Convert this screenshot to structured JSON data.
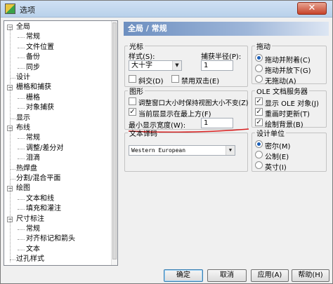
{
  "window": {
    "title": "选项",
    "close_glyph": "✕"
  },
  "tree": {
    "items": [
      {
        "label": "全局",
        "level": 0,
        "expander": "−"
      },
      {
        "label": "常规",
        "level": 1
      },
      {
        "label": "文件位置",
        "level": 1
      },
      {
        "label": "备份",
        "level": 1
      },
      {
        "label": "同步",
        "level": 1
      },
      {
        "label": "设计",
        "level": 0
      },
      {
        "label": "栅格和捕获",
        "level": 0,
        "expander": "−"
      },
      {
        "label": "栅格",
        "level": 1
      },
      {
        "label": "对象捕获",
        "level": 1
      },
      {
        "label": "显示",
        "level": 0
      },
      {
        "label": "布线",
        "level": 0,
        "expander": "−"
      },
      {
        "label": "常规",
        "level": 1
      },
      {
        "label": "调整/差分对",
        "level": 1
      },
      {
        "label": "泪滴",
        "level": 1
      },
      {
        "label": "热焊盘",
        "level": 0
      },
      {
        "label": "分割/混合平面",
        "level": 0
      },
      {
        "label": "绘图",
        "level": 0,
        "expander": "−"
      },
      {
        "label": "文本和线",
        "level": 1
      },
      {
        "label": "填充和灌注",
        "level": 1
      },
      {
        "label": "尺寸标注",
        "level": 0,
        "expander": "−"
      },
      {
        "label": "常规",
        "level": 1
      },
      {
        "label": "对齐标记和箭头",
        "level": 1
      },
      {
        "label": "文本",
        "level": 1
      },
      {
        "label": "过孔样式",
        "level": 0
      }
    ]
  },
  "panel": {
    "header": "全局 / 常规",
    "cursor": {
      "legend": "光标",
      "style_label": "样式(S):",
      "style_value": "大十字",
      "snap_label": "捕获半径(P):",
      "snap_value": "1",
      "italic_label": "斜交(D)",
      "italic_checked": false,
      "nodbl_label": "禁用双击(E)",
      "nodbl_checked": false
    },
    "graphics": {
      "legend": "图形",
      "keep_view_label": "调整窗口大小时保持视图大小不变(Z)",
      "keep_view_checked": false,
      "current_top_label": "当前层显示在最上方(F)",
      "current_top_checked": true,
      "min_width_label": "最小显示宽度(W):",
      "min_width_value": "1"
    },
    "text_encoding": {
      "legend": "文本译码",
      "value": "Western European"
    },
    "drag": {
      "legend": "拖动",
      "options": [
        {
          "label": "拖动并附着(C)",
          "selected": true
        },
        {
          "label": "拖动并放下(G)",
          "selected": false
        },
        {
          "label": "无拖动(A)",
          "selected": false
        }
      ]
    },
    "ole": {
      "legend": "OLE 文档服务器",
      "options": [
        {
          "label": "显示 OLE 对象(J)",
          "checked": true
        },
        {
          "label": "重画时更新(T)",
          "checked": true
        },
        {
          "label": "绘制背景(B)",
          "checked": true
        }
      ]
    },
    "units": {
      "legend": "设计单位",
      "options": [
        {
          "label": "密尔(M)",
          "selected": true
        },
        {
          "label": "公制(E)",
          "selected": false
        },
        {
          "label": "英寸(I)",
          "selected": false
        }
      ]
    }
  },
  "footer": {
    "ok_label": "确定",
    "cancel_label": "取消",
    "apply_label": "应用(A)",
    "help_label": "帮助(H)"
  },
  "colors": {
    "accent_underline": "#d81e1e",
    "header_gradient_start": "#6d8fc0"
  }
}
